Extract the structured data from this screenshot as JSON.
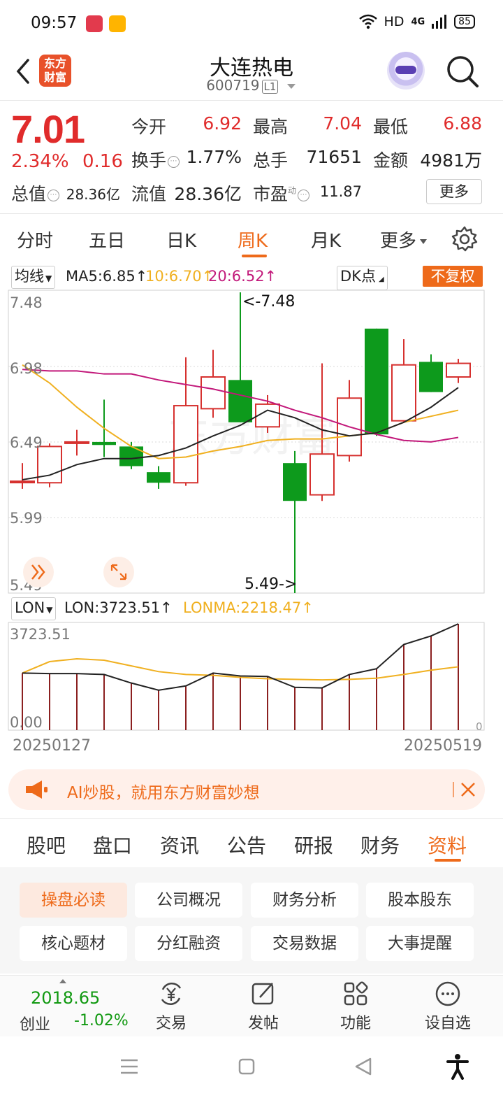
{
  "status": {
    "time": "09:57",
    "network": "HD",
    "net2": "4G",
    "battery": "85"
  },
  "header": {
    "title": "大连热电",
    "code": "600719",
    "code_tag": "L1",
    "logo_line1": "东方",
    "logo_line2": "财富"
  },
  "quote": {
    "price": "7.01",
    "change_pct": "2.34%",
    "change_abs": "0.16",
    "open_label": "今开",
    "open": "6.92",
    "high_label": "最高",
    "high": "7.04",
    "low_label": "最低",
    "low": "6.88",
    "turnover_label": "换手",
    "turnover": "1.77%",
    "volume_label": "总手",
    "volume": "71651",
    "amount_label": "金额",
    "amount": "4981万",
    "mktcap_label": "总值",
    "mktcap": "28.36亿",
    "float_label": "流值",
    "float": "28.36亿",
    "pe_label": "市盈",
    "pe_sup": "动",
    "pe": "11.87",
    "more": "更多"
  },
  "period_tabs": [
    "分时",
    "五日",
    "日K",
    "周K",
    "月K",
    "更多"
  ],
  "active_period": "周K",
  "indicator": {
    "ma_select": "均线",
    "ma5": "MA5:6.85↑",
    "ma10": "10:6.70↑",
    "ma20": "20:6.52↑",
    "dk": "DK点",
    "adjust": "不复权",
    "lon_select": "LON",
    "lon": "LON:3723.51↑",
    "lonma": "LONMA:2218.47↑"
  },
  "colors": {
    "up": "#d6312f",
    "down": "#0d9a1c",
    "ma5": "#222222",
    "ma10": "#f0b020",
    "ma20": "#c2187a",
    "accent": "#ee6a1a"
  },
  "chart_data": [
    {
      "type": "candlestick",
      "price_axis_labels": [
        "7.48",
        "6.98",
        "6.49",
        "5.99",
        "5.49"
      ],
      "ylim": [
        5.49,
        7.48
      ],
      "max_label": "<-7.48",
      "min_label": "5.49->",
      "candles": [
        {
          "o": 6.23,
          "c": 6.23,
          "h": 6.35,
          "l": 6.18
        },
        {
          "o": 6.22,
          "c": 6.46,
          "h": 6.48,
          "l": 6.19
        },
        {
          "o": 6.49,
          "c": 6.49,
          "h": 6.57,
          "l": 6.4
        },
        {
          "o": 6.49,
          "c": 6.47,
          "h": 6.77,
          "l": 6.39
        },
        {
          "o": 6.46,
          "c": 6.33,
          "h": 6.49,
          "l": 6.31
        },
        {
          "o": 6.29,
          "c": 6.22,
          "h": 6.33,
          "l": 6.18
        },
        {
          "o": 6.22,
          "c": 6.73,
          "h": 7.05,
          "l": 6.2
        },
        {
          "o": 6.71,
          "c": 6.92,
          "h": 7.1,
          "l": 6.65
        },
        {
          "o": 6.9,
          "c": 6.62,
          "h": 7.48,
          "l": 6.62
        },
        {
          "o": 6.59,
          "c": 6.74,
          "h": 6.8,
          "l": 6.55
        },
        {
          "o": 6.35,
          "c": 6.1,
          "h": 6.43,
          "l": 5.49
        },
        {
          "o": 6.14,
          "c": 6.41,
          "h": 7.01,
          "l": 6.1
        },
        {
          "o": 6.4,
          "c": 6.78,
          "h": 6.9,
          "l": 6.36
        },
        {
          "o": 7.24,
          "c": 6.54,
          "h": 7.24,
          "l": 6.53
        },
        {
          "o": 6.63,
          "c": 7.0,
          "h": 7.17,
          "l": 6.62
        },
        {
          "o": 7.02,
          "c": 6.82,
          "h": 7.07,
          "l": 6.82
        },
        {
          "o": 6.92,
          "c": 7.01,
          "h": 7.04,
          "l": 6.88
        }
      ],
      "ma5": [
        6.24,
        6.27,
        6.34,
        6.38,
        6.38,
        6.4,
        6.45,
        6.53,
        6.6,
        6.7,
        6.65,
        6.57,
        6.53,
        6.55,
        6.62,
        6.72,
        6.85
      ],
      "ma10": [
        7.0,
        6.88,
        6.72,
        6.58,
        6.46,
        6.38,
        6.39,
        6.43,
        6.46,
        6.5,
        6.51,
        6.51,
        6.53,
        6.55,
        6.62,
        6.66,
        6.7
      ],
      "ma20": [
        6.97,
        6.96,
        6.96,
        6.94,
        6.94,
        6.9,
        6.87,
        6.84,
        6.8,
        6.76,
        6.7,
        6.65,
        6.59,
        6.54,
        6.5,
        6.49,
        6.52
      ]
    },
    {
      "type": "bar+line",
      "name": "LON",
      "axis_labels": [
        "3723.51",
        "0.00"
      ],
      "right_label": "0",
      "ylim": [
        0,
        3723.51
      ],
      "bars": [
        2000,
        1980,
        1980,
        1950,
        1650,
        1400,
        1550,
        2000,
        1900,
        1880,
        1500,
        1480,
        1950,
        2150,
        3000,
        3300,
        3723.51
      ],
      "lon": [
        2000,
        1980,
        1980,
        1950,
        1650,
        1400,
        1550,
        2000,
        1900,
        1880,
        1500,
        1480,
        1950,
        2150,
        3000,
        3300,
        3723.51
      ],
      "lonma": [
        2000,
        2400,
        2500,
        2450,
        2250,
        2050,
        1950,
        1920,
        1850,
        1800,
        1780,
        1760,
        1780,
        1820,
        1950,
        2100,
        2218.47
      ],
      "x_start": "20250127",
      "x_end": "20250519"
    }
  ],
  "ad": {
    "text": "AI炒股，就用东方财富妙想"
  },
  "bottom_tabs": [
    "股吧",
    "盘口",
    "资讯",
    "公告",
    "研报",
    "财务",
    "资料"
  ],
  "active_bottom_tab": "资料",
  "grid_buttons": [
    "操盘必读",
    "公司概况",
    "财务分析",
    "股本股东",
    "核心题材",
    "分红融资",
    "交易数据",
    "大事提醒"
  ],
  "toolbar": {
    "index_value": "2018.65",
    "index_name": "创业",
    "index_change": "-1.02%",
    "trade": "交易",
    "post": "发帖",
    "functions": "功能",
    "add_fav": "设自选"
  }
}
